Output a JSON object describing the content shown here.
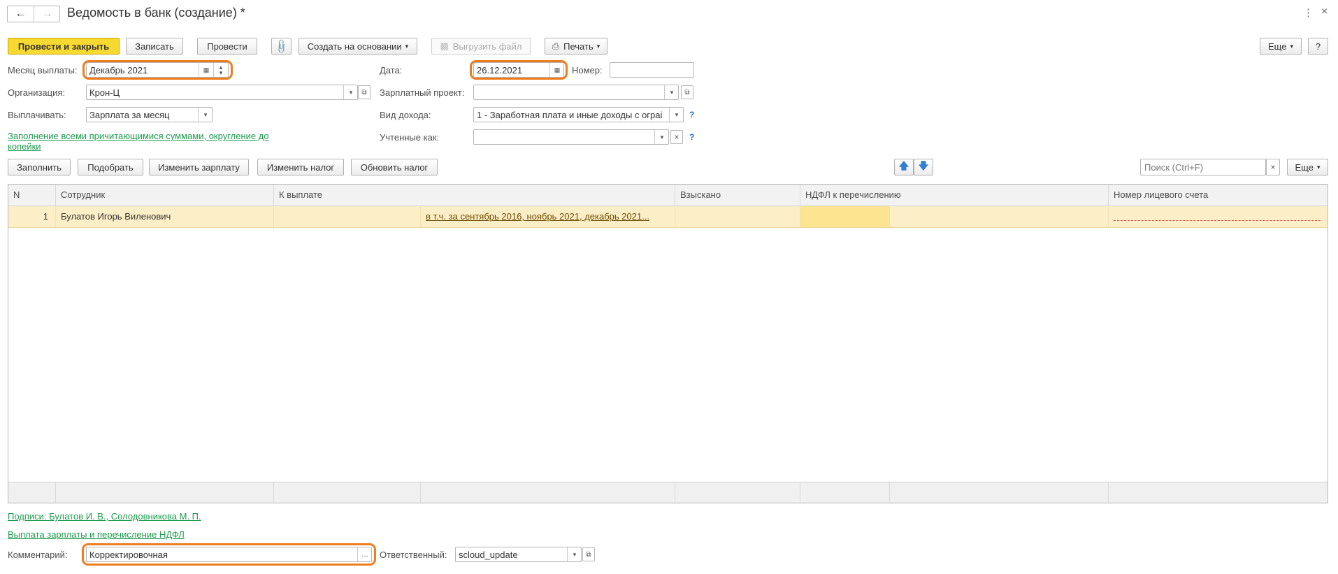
{
  "window": {
    "title": "Ведомость в банк (создание) *"
  },
  "toolbar": {
    "post_close": "Провести и закрыть",
    "save": "Записать",
    "post": "Провести",
    "create_based": "Создать на основании",
    "export_file": "Выгрузить файл",
    "print": "Печать",
    "more": "Еще",
    "help": "?"
  },
  "form": {
    "month_label": "Месяц выплаты:",
    "month_value": "Декабрь 2021",
    "org_label": "Организация:",
    "org_value": "Крон-Ц",
    "pay_label": "Выплачивать:",
    "pay_value": "Зарплата за месяц",
    "fill_link_line1": "Заполнение всеми причитающимися суммами, округление до",
    "fill_link_line2": "копейки",
    "date_label": "Дата:",
    "date_value": "26.12.2021",
    "number_label": "Номер:",
    "number_value": "",
    "salary_project_label": "Зарплатный проект:",
    "salary_project_value": "",
    "income_type_label": "Вид дохода:",
    "income_type_value": "1 - Заработная плата и иные доходы с ограі",
    "counted_as_label": "Учтенные как:",
    "counted_as_value": ""
  },
  "table_toolbar": {
    "fill": "Заполнить",
    "pick": "Подобрать",
    "change_salary": "Изменить зарплату",
    "change_tax": "Изменить налог",
    "refresh_tax": "Обновить налог",
    "search_placeholder": "Поиск (Ctrl+F)",
    "more": "Еще"
  },
  "table": {
    "columns": [
      "N",
      "Сотрудник",
      "К выплате",
      "Взыскано",
      "НДФЛ к перечислению",
      "Номер лицевого счета"
    ],
    "rows": [
      {
        "n": "1",
        "employee": "Булатов Игорь Виленович",
        "to_pay": "",
        "to_pay_link": "в т.ч. за сентябрь 2016, ноябрь 2021, декабрь 2021...",
        "withheld": "",
        "ndfl": "",
        "account": ""
      }
    ]
  },
  "footer": {
    "signatures_link": "Подписи: Булатов И. В., Солодовникова М. П.",
    "payment_link": "Выплата зарплаты и перечисление НДФЛ",
    "comment_label": "Комментарий:",
    "comment_value": "Корректировочная",
    "responsible_label": "Ответственный:",
    "responsible_value": "scloud_update"
  },
  "colors": {
    "primary_button": "#f7d931",
    "highlight_outline": "#ee7d20",
    "link": "#1a9c4b",
    "selected_row": "#fcefc7"
  }
}
